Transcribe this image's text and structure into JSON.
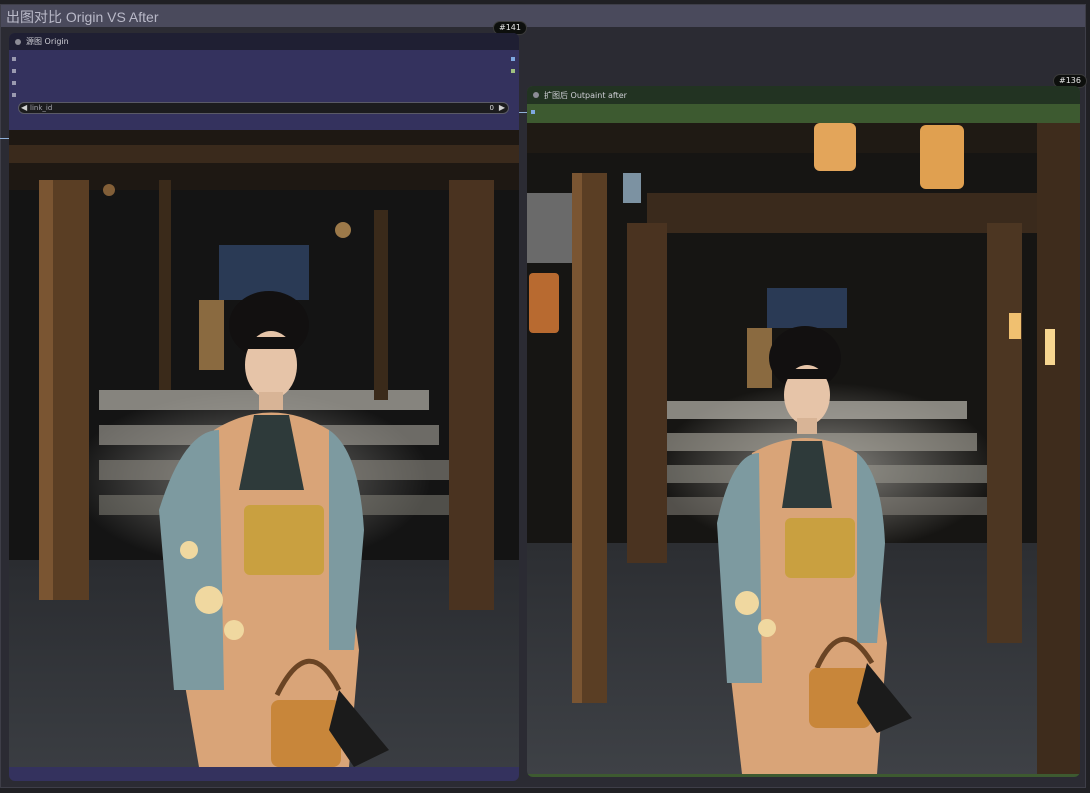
{
  "group": {
    "title": "出图对比 Origin VS After"
  },
  "nodes": {
    "origin": {
      "badge": "#141",
      "title": "源图 Origin",
      "widget": {
        "label": "link_id",
        "value": "0",
        "left_arrow": "◀",
        "right_arrow": "▶"
      },
      "image_alt": "woman-in-kimono-original"
    },
    "after": {
      "badge": "#136",
      "title": "扩图后 Outpaint after",
      "image_alt": "woman-in-kimono-outpainted"
    }
  },
  "colors": {
    "origin_node": "#34325e",
    "after_node": "#3d5a30",
    "after_title": "#223322",
    "origin_title": "#1f1f33"
  }
}
